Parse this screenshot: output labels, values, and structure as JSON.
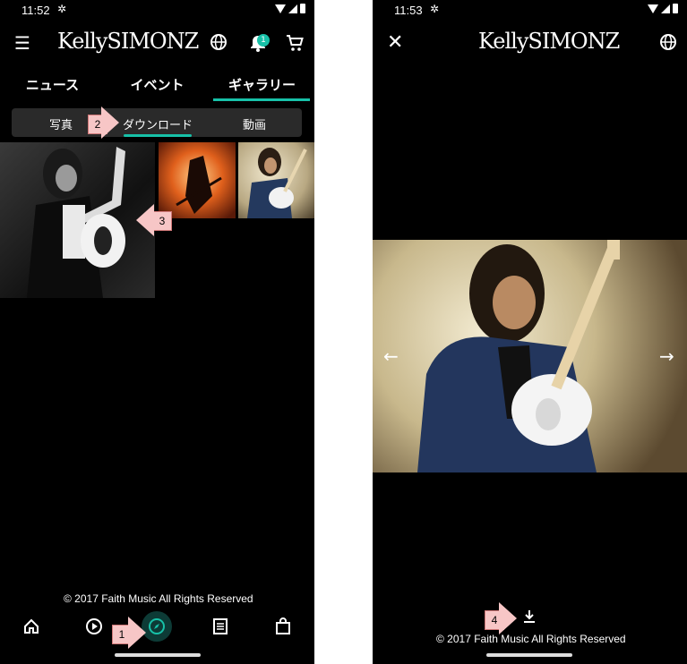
{
  "left": {
    "status_time": "11:52",
    "logo": "KellySIMONZ",
    "badge_count": "1",
    "tabs": [
      "ニュース",
      "イベント",
      "ギャラリー"
    ],
    "segments": [
      "写真",
      "ダウンロード",
      "動画"
    ],
    "copyright": "© 2017 Faith Music All Rights Reserved",
    "annotations": [
      "1",
      "2",
      "3"
    ],
    "icons": {
      "menu": "menu-icon",
      "globe": "globe-icon",
      "bell": "bell-icon",
      "cart": "cart-icon",
      "home": "home-icon",
      "play": "play-icon",
      "explore": "compass-icon",
      "news": "document-icon",
      "shop": "shopping-bag-icon"
    }
  },
  "right": {
    "status_time": "11:53",
    "logo": "KellySIMONZ",
    "copyright": "© 2017 Faith Music All Rights Reserved",
    "annotation": "4",
    "icons": {
      "close": "close-icon",
      "globe": "globe-icon",
      "prev": "arrow-left-icon",
      "next": "arrow-right-icon",
      "download": "download-icon"
    }
  },
  "colors": {
    "accent": "#17c1a8",
    "background": "#000000",
    "annotation": "#f7c6c6"
  }
}
